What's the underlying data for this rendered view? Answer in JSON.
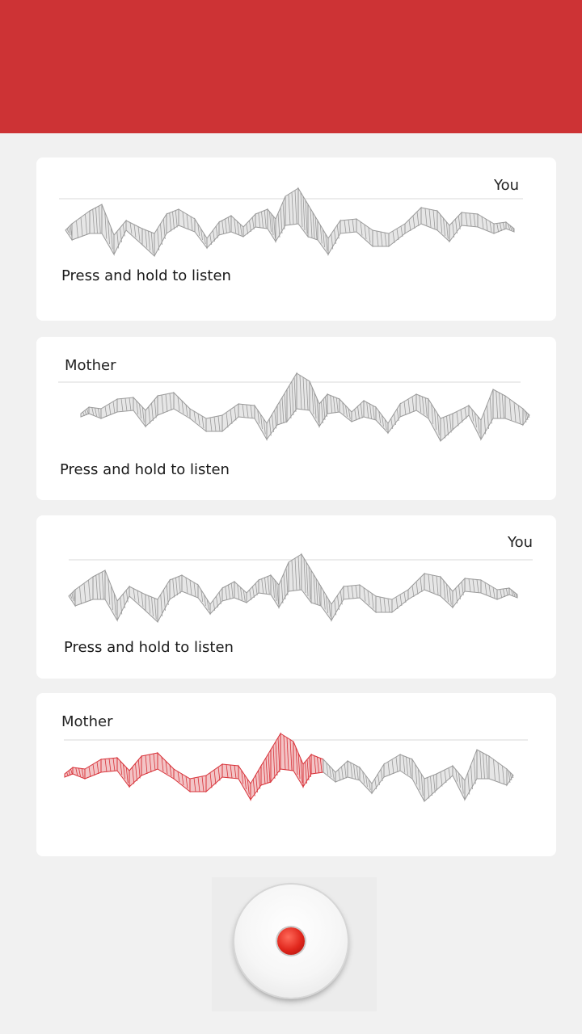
{
  "header": {
    "color": "#cd3335"
  },
  "messages": [
    {
      "speaker": "You",
      "hint": "Press and hold to listen",
      "progress": 0
    },
    {
      "speaker": "Mother",
      "hint": "Press and hold to listen",
      "progress": 0
    },
    {
      "speaker": "You",
      "hint": "Press and hold to listen",
      "progress": 0
    },
    {
      "speaker": "Mother",
      "hint": "",
      "progress": 0.6
    }
  ],
  "record": {
    "icon": "record-icon",
    "accent": "#e0261c"
  },
  "colors": {
    "wave_idle": "#9a9a9a",
    "wave_playing": "#d8333a"
  }
}
